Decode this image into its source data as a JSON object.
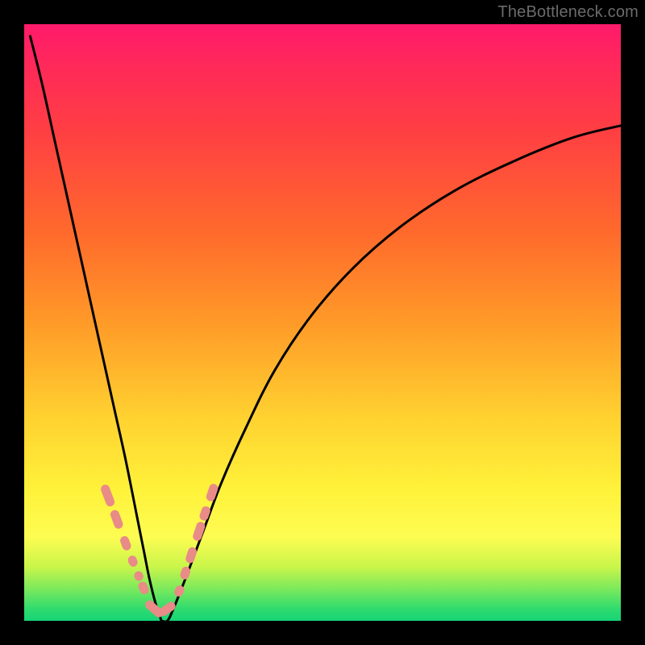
{
  "watermark": "TheBottleneck.com",
  "colors": {
    "background": "#000000",
    "curve": "#000000",
    "marker": "#e98b87",
    "watermark_text": "#6b6b6b"
  },
  "chart_data": {
    "type": "line",
    "title": "",
    "xlabel": "",
    "ylabel": "",
    "xlim": [
      0,
      100
    ],
    "ylim": [
      0,
      100
    ],
    "grid": false,
    "legend": false,
    "annotations": [
      "TheBottleneck.com"
    ],
    "series": [
      {
        "name": "bottleneck-curve",
        "comment": "V-shaped curve; y is read as height above bottom of plot area (0 at green band, 100 at top). Values estimated from pixels.",
        "x": [
          1,
          3,
          5,
          7,
          9,
          11,
          13,
          15,
          17,
          19,
          20,
          21,
          22,
          23,
          24,
          25,
          27,
          30,
          33,
          37,
          42,
          48,
          55,
          63,
          72,
          82,
          92,
          100
        ],
        "y": [
          98,
          90,
          81,
          72,
          63,
          54,
          45,
          36,
          27,
          17,
          12,
          7,
          3,
          0,
          0,
          2,
          7,
          15,
          23,
          32,
          42,
          51,
          59,
          66,
          72,
          77,
          81,
          83
        ]
      }
    ],
    "markers": {
      "name": "highlight-capsules",
      "comment": "pink rounded segments overlaid on the curve near the minimum",
      "x": [
        14.0,
        15.5,
        17.0,
        18.2,
        19.2,
        20.0,
        21.8,
        24.0,
        26.0,
        27.0,
        28.0,
        29.3,
        30.3,
        31.5
      ],
      "y": [
        21.0,
        17.0,
        13.0,
        10.0,
        7.5,
        5.5,
        2.0,
        2.0,
        5.0,
        8.0,
        11.0,
        15.0,
        18.0,
        21.5
      ]
    }
  }
}
